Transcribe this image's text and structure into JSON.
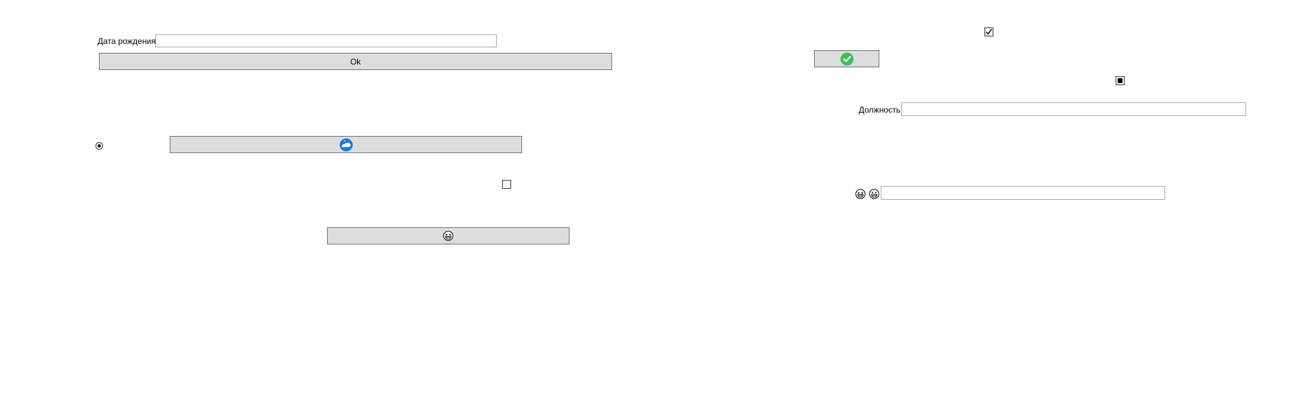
{
  "birth_date": {
    "label": "Дата рождения",
    "value": ""
  },
  "ok_button": {
    "label": "Ok"
  },
  "position": {
    "label": "Должность",
    "value": ""
  },
  "emoji_field": {
    "value": ""
  },
  "checkbox_top": {
    "checked": true
  },
  "checkbox_mid": {
    "state": "indeterminate"
  },
  "checkbox_left": {
    "checked": false
  },
  "radio_left": {
    "selected": true
  },
  "icons": {
    "confirm_button_icon": "green-check-circle-icon",
    "map_button_icon": "blue-globe-icon",
    "emoji_button_icon": "grinning-squint-face-icon",
    "emoji_field_icons": [
      "grinning-squint-face-icon",
      "grinning-face-icon"
    ]
  },
  "colors": {
    "button_bg": "#dddddd",
    "button_border": "#707070",
    "input_border": "#a9a9a9",
    "check_green": "#3dbf55",
    "globe_blue": "#1e78d7"
  }
}
